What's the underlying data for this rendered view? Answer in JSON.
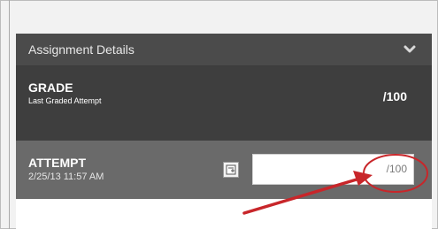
{
  "assignment_details": {
    "title": "Assignment Details",
    "toggle_icon": "chevron-down-icon"
  },
  "grade": {
    "label": "GRADE",
    "sublabel": "Last Graded Attempt",
    "score": "/100"
  },
  "attempt": {
    "label": "ATTEMPT",
    "date": "2/25/13 11:57 AM",
    "notes_icon": "notes-icon",
    "input_value": "",
    "input_suffix": "/100"
  },
  "annotation": {
    "circle_color": "#c8262a",
    "arrow_color": "#c8262a"
  }
}
